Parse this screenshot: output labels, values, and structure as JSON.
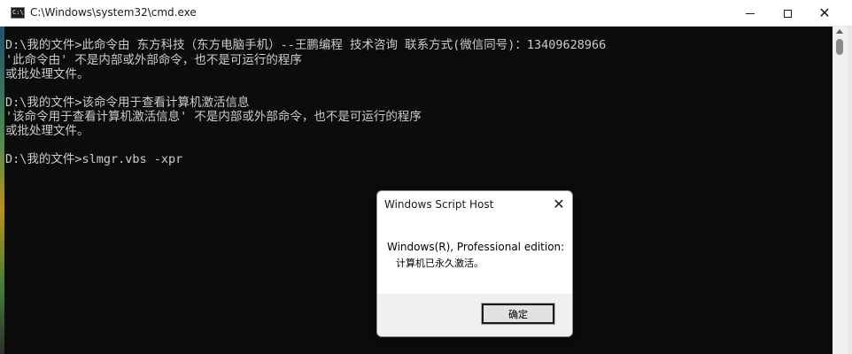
{
  "window": {
    "title": "C:\\Windows\\system32\\cmd.exe",
    "icon": "cmd-icon",
    "icon_text": "C:\\",
    "minimize_icon": "minimize-icon",
    "maximize_icon": "maximize-icon",
    "close_icon": "close-icon",
    "close_glyph": "✕"
  },
  "console": {
    "lines": [
      "D:\\我的文件>此命令由 东方科技（东方电脑手机）--王鹏编程 技术咨询 联系方式(微信同号)：13409628966",
      "'此命令由' 不是内部或外部命令，也不是可运行的程序",
      "或批处理文件。",
      "",
      "D:\\我的文件>该命令用于查看计算机激活信息",
      "'该命令用于查看计算机激活信息' 不是内部或外部命令，也不是可运行的程序",
      "或批处理文件。",
      "",
      "D:\\我的文件>slmgr.vbs -xpr"
    ],
    "text_color": "#cccccc",
    "background": "#0c0c0c"
  },
  "dialog": {
    "title": "Windows Script Host",
    "close_glyph": "✕",
    "message_line1": "Windows(R), Professional edition:",
    "message_line2": "计算机已永久激活。",
    "ok_label": "确定"
  }
}
